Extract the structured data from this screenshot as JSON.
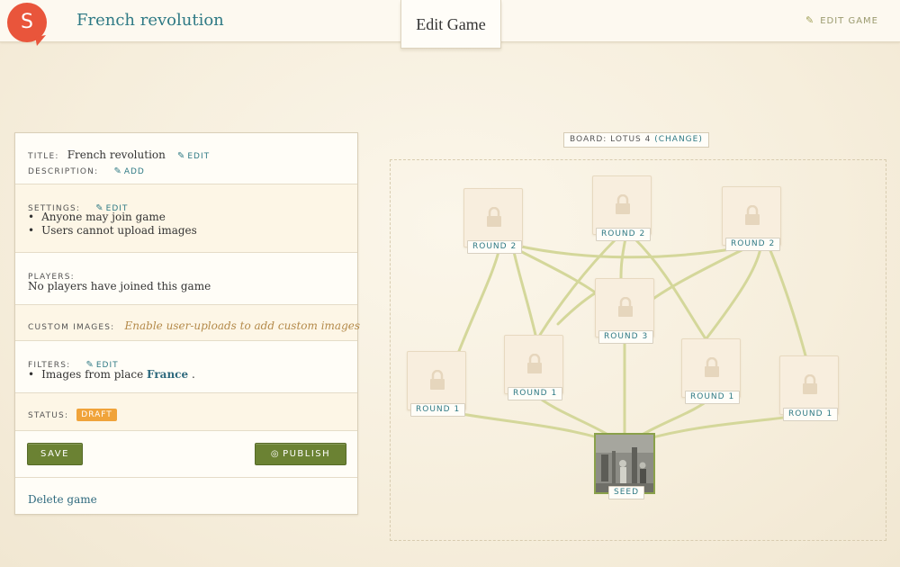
{
  "header": {
    "logo_letter": "S",
    "game_title": "French revolution",
    "active_tab": "Edit Game",
    "edit_game_link": "EDIT GAME"
  },
  "panel": {
    "title_label": "TITLE:",
    "title_value": "French revolution",
    "title_edit": "EDIT",
    "description_label": "DESCRIPTION:",
    "description_add": "ADD",
    "settings_label": "SETTINGS:",
    "settings_edit": "EDIT",
    "settings_items": [
      "Anyone may join game",
      "Users cannot upload images"
    ],
    "players_label": "PLAYERS:",
    "players_value": "No players have joined this game",
    "custom_images_label": "CUSTOM IMAGES:",
    "custom_images_note": "Enable user-uploads to add custom images",
    "filters_label": "FILTERS:",
    "filters_edit": "EDIT",
    "filters_prefix": "Images from place",
    "filters_place": "France",
    "filters_suffix": ".",
    "status_label": "STATUS:",
    "status_badge": "DRAFT",
    "save_button": "SAVE",
    "publish_button": "PUBLISH",
    "delete_link": "Delete game"
  },
  "board": {
    "label_prefix": "BOARD: LOTUS 4",
    "change_link": "(CHANGE)",
    "tiles": [
      {
        "label": "ROUND 2",
        "status": "locked"
      },
      {
        "label": "ROUND 2",
        "status": "locked"
      },
      {
        "label": "ROUND 2",
        "status": "locked"
      },
      {
        "label": "ROUND 3",
        "status": "locked"
      },
      {
        "label": "ROUND 1",
        "status": "locked"
      },
      {
        "label": "ROUND 1",
        "status": "locked"
      },
      {
        "label": "ROUND 1",
        "status": "locked"
      },
      {
        "label": "ROUND 1",
        "status": "locked"
      }
    ],
    "seed_label": "SEED"
  },
  "colors": {
    "accent_teal": "#2f7a85",
    "button_green": "#6b8233",
    "draft_orange": "#f0a33a",
    "logo_red": "#e9553b",
    "wire_green": "#d4d79a"
  }
}
